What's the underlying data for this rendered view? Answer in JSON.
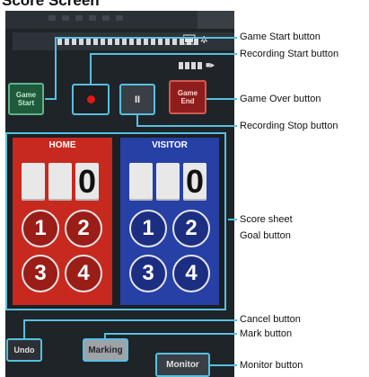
{
  "title": "Score Screen",
  "toolbar": {
    "game_start_label": "Game Start",
    "game_end_label": "Game End",
    "stop_label": "II"
  },
  "scoreboard": {
    "home_label": "HOME",
    "visitor_label": "VISITOR",
    "home_score": "0",
    "visitor_score": "0",
    "goal_buttons": [
      "1",
      "2",
      "3",
      "4"
    ]
  },
  "bottom": {
    "undo_label": "Undo",
    "marking_label": "Marking",
    "monitor_label": "Monitor"
  },
  "callouts": {
    "game_start": "Game Start button",
    "recording_start": "Recording Start button",
    "game_over": "Game Over button",
    "recording_stop": "Recording Stop button",
    "score_sheet": "Score sheet",
    "goal_button": "Goal button",
    "cancel": "Cancel button",
    "mark": "Mark button",
    "monitor": "Monitor button"
  },
  "colors": {
    "callout_line": "#56c0e0",
    "home": "#c8291f",
    "visitor": "#2640a6"
  }
}
